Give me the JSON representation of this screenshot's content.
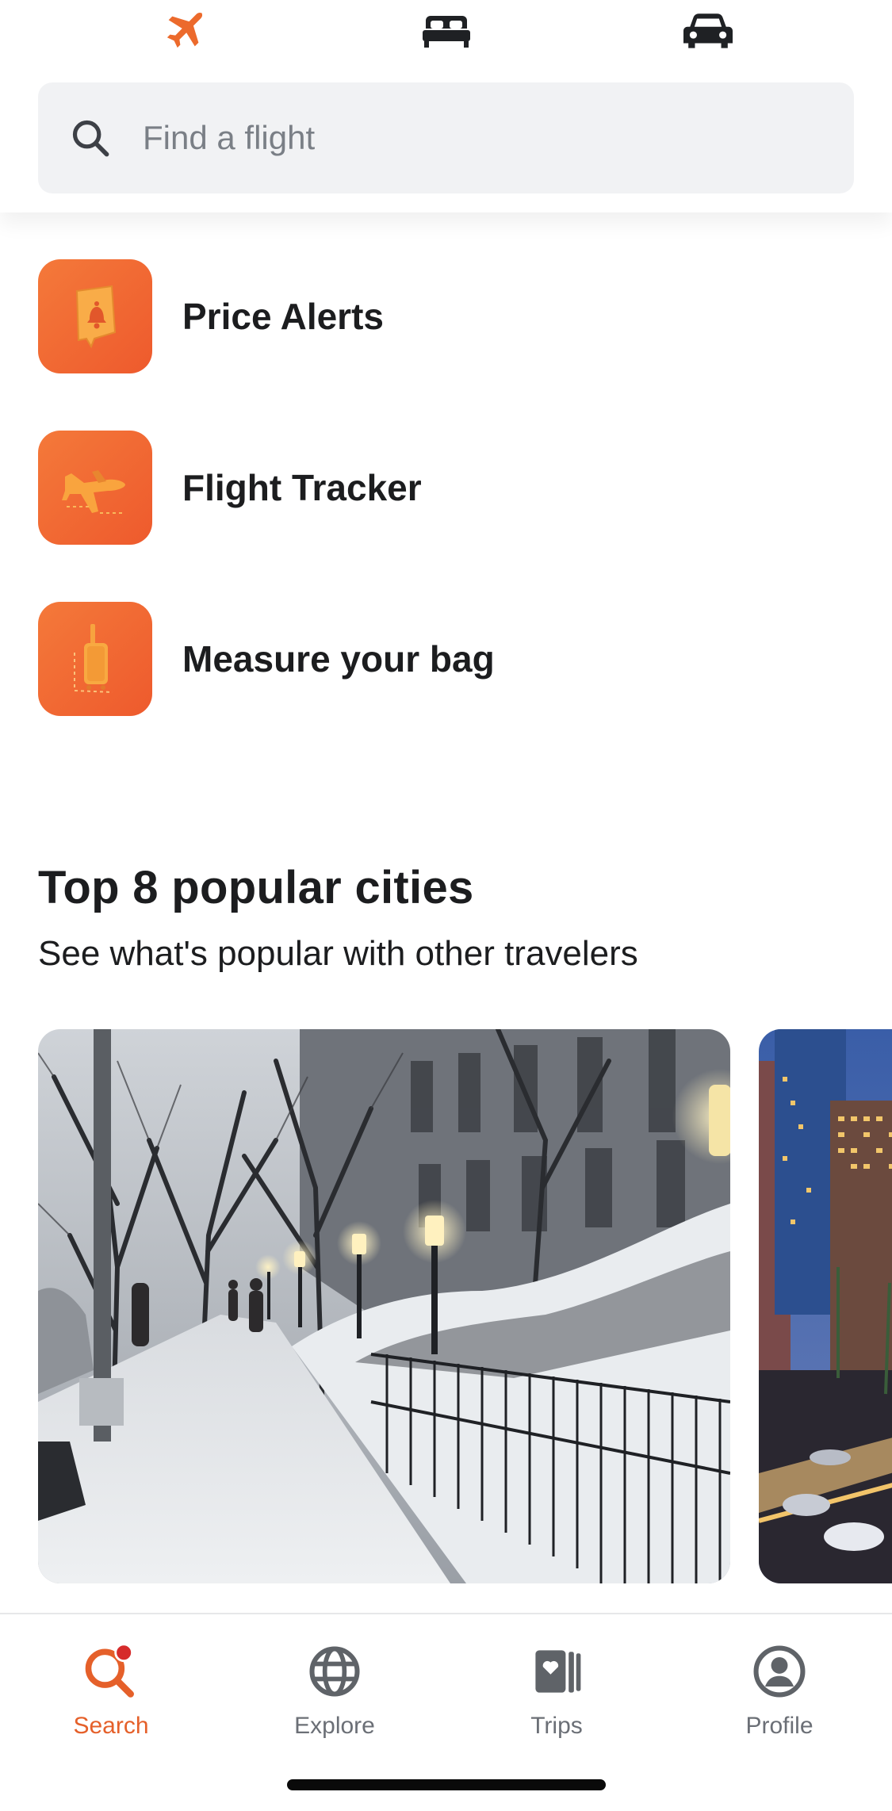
{
  "verticals": [
    {
      "name": "flights",
      "icon": "airplane-icon",
      "active": true
    },
    {
      "name": "stays",
      "icon": "bed-icon",
      "active": false
    },
    {
      "name": "cars",
      "icon": "car-icon",
      "active": false
    }
  ],
  "search": {
    "placeholder": "Find a flight",
    "value": ""
  },
  "tools": [
    {
      "label": "Price Alerts",
      "icon": "price-alert-bell-icon"
    },
    {
      "label": "Flight Tracker",
      "icon": "flight-tracker-plane-icon"
    },
    {
      "label": "Measure your bag",
      "icon": "luggage-icon"
    }
  ],
  "popular": {
    "title": "Top 8 popular cities",
    "subtitle": "See what's popular with other travelers"
  },
  "bottom_nav": [
    {
      "label": "Search",
      "icon": "search-icon",
      "active": true
    },
    {
      "label": "Explore",
      "icon": "globe-icon",
      "active": false
    },
    {
      "label": "Trips",
      "icon": "trips-icon",
      "active": false
    },
    {
      "label": "Profile",
      "icon": "profile-icon",
      "active": false
    }
  ],
  "colors": {
    "accent": "#e5602a",
    "tool_gradient_start": "#f4793a",
    "tool_gradient_end": "#ee5a2d",
    "search_bg": "#f1f2f4",
    "inactive_icon": "#5f6368",
    "notification_dot": "#d62b2b"
  }
}
